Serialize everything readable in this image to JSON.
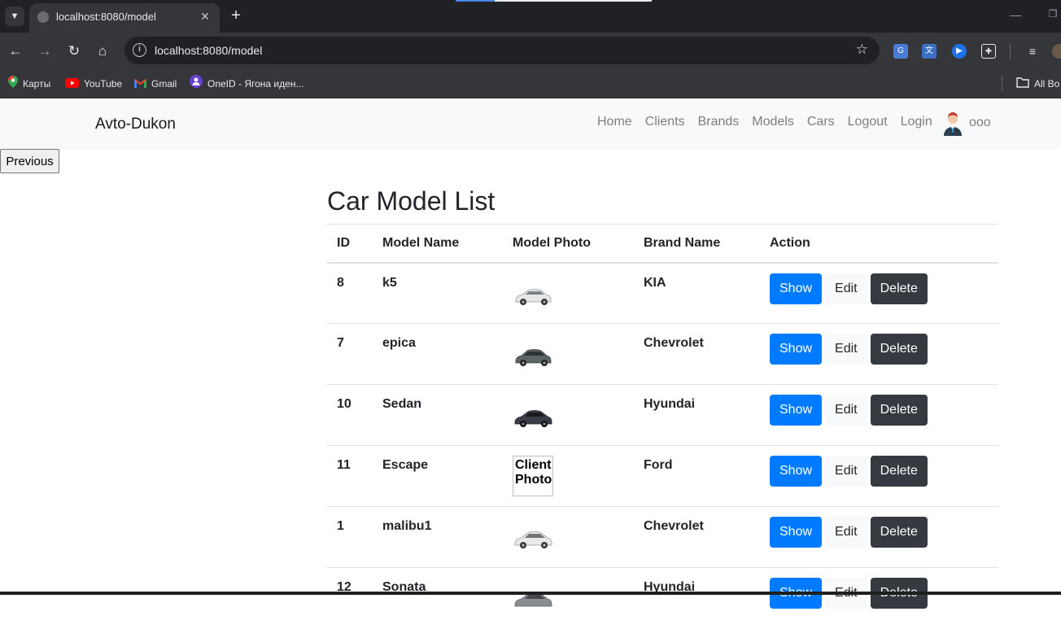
{
  "browser": {
    "tab_title": "localhost:8080/model",
    "url": "localhost:8080/model",
    "bookmarks": [
      {
        "label": "Карты"
      },
      {
        "label": "YouTube"
      },
      {
        "label": "Gmail"
      },
      {
        "label": "OneID - Ягона иден..."
      }
    ],
    "all_bookmarks_label": "All Bo"
  },
  "site": {
    "brand": "Avto-Dukon",
    "nav": [
      "Home",
      "Clients",
      "Brands",
      "Models",
      "Cars",
      "Logout",
      "Login"
    ],
    "username": "ooo"
  },
  "previous_button": "Previous",
  "page_title": "Car Model List",
  "table": {
    "headers": [
      "ID",
      "Model Name",
      "Model Photo",
      "Brand Name",
      "Action"
    ],
    "rows": [
      {
        "id": "8",
        "model": "k5",
        "brand": "KIA",
        "photo_alt": ""
      },
      {
        "id": "7",
        "model": "epica",
        "brand": "Chevrolet",
        "photo_alt": ""
      },
      {
        "id": "10",
        "model": "Sedan",
        "brand": "Hyundai",
        "photo_alt": ""
      },
      {
        "id": "11",
        "model": "Escape",
        "brand": "Ford",
        "photo_alt": "Client Photo"
      },
      {
        "id": "1",
        "model": "malibu1",
        "brand": "Chevrolet",
        "photo_alt": ""
      },
      {
        "id": "12",
        "model": "Sonata",
        "brand": "Hyundai",
        "photo_alt": ""
      }
    ],
    "actions": {
      "show": "Show",
      "edit": "Edit",
      "delete": "Delete"
    }
  },
  "colors": {
    "show": "#007bff",
    "delete": "#343a40",
    "edit": "#f8f9fa",
    "car_colors": [
      "#e6e6e6",
      "#5b6568",
      "#3a3d48",
      "#ffffff",
      "#e9e9e9",
      "#8a8d92"
    ]
  }
}
